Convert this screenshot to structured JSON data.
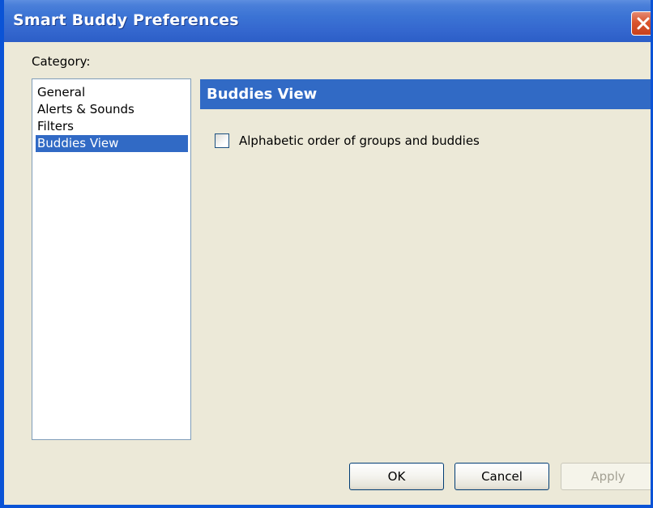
{
  "window": {
    "title": "Smart Buddy Preferences",
    "close_icon": "close-icon"
  },
  "category": {
    "label": "Category:",
    "items": [
      {
        "label": "General"
      },
      {
        "label": "Alerts & Sounds"
      },
      {
        "label": "Filters"
      },
      {
        "label": "Buddies View",
        "selected": true
      }
    ]
  },
  "panel": {
    "title": "Buddies View",
    "options": [
      {
        "label": "Alphabetic order of groups and buddies",
        "checked": false
      }
    ]
  },
  "buttons": {
    "ok_label": "OK",
    "cancel_label": "Cancel",
    "apply_label": "Apply",
    "apply_enabled": false
  },
  "colors": {
    "title_bar": "#3b73d4",
    "selection": "#316ac5",
    "close_button": "#d9542e",
    "dialog_background": "#ece9d8"
  }
}
